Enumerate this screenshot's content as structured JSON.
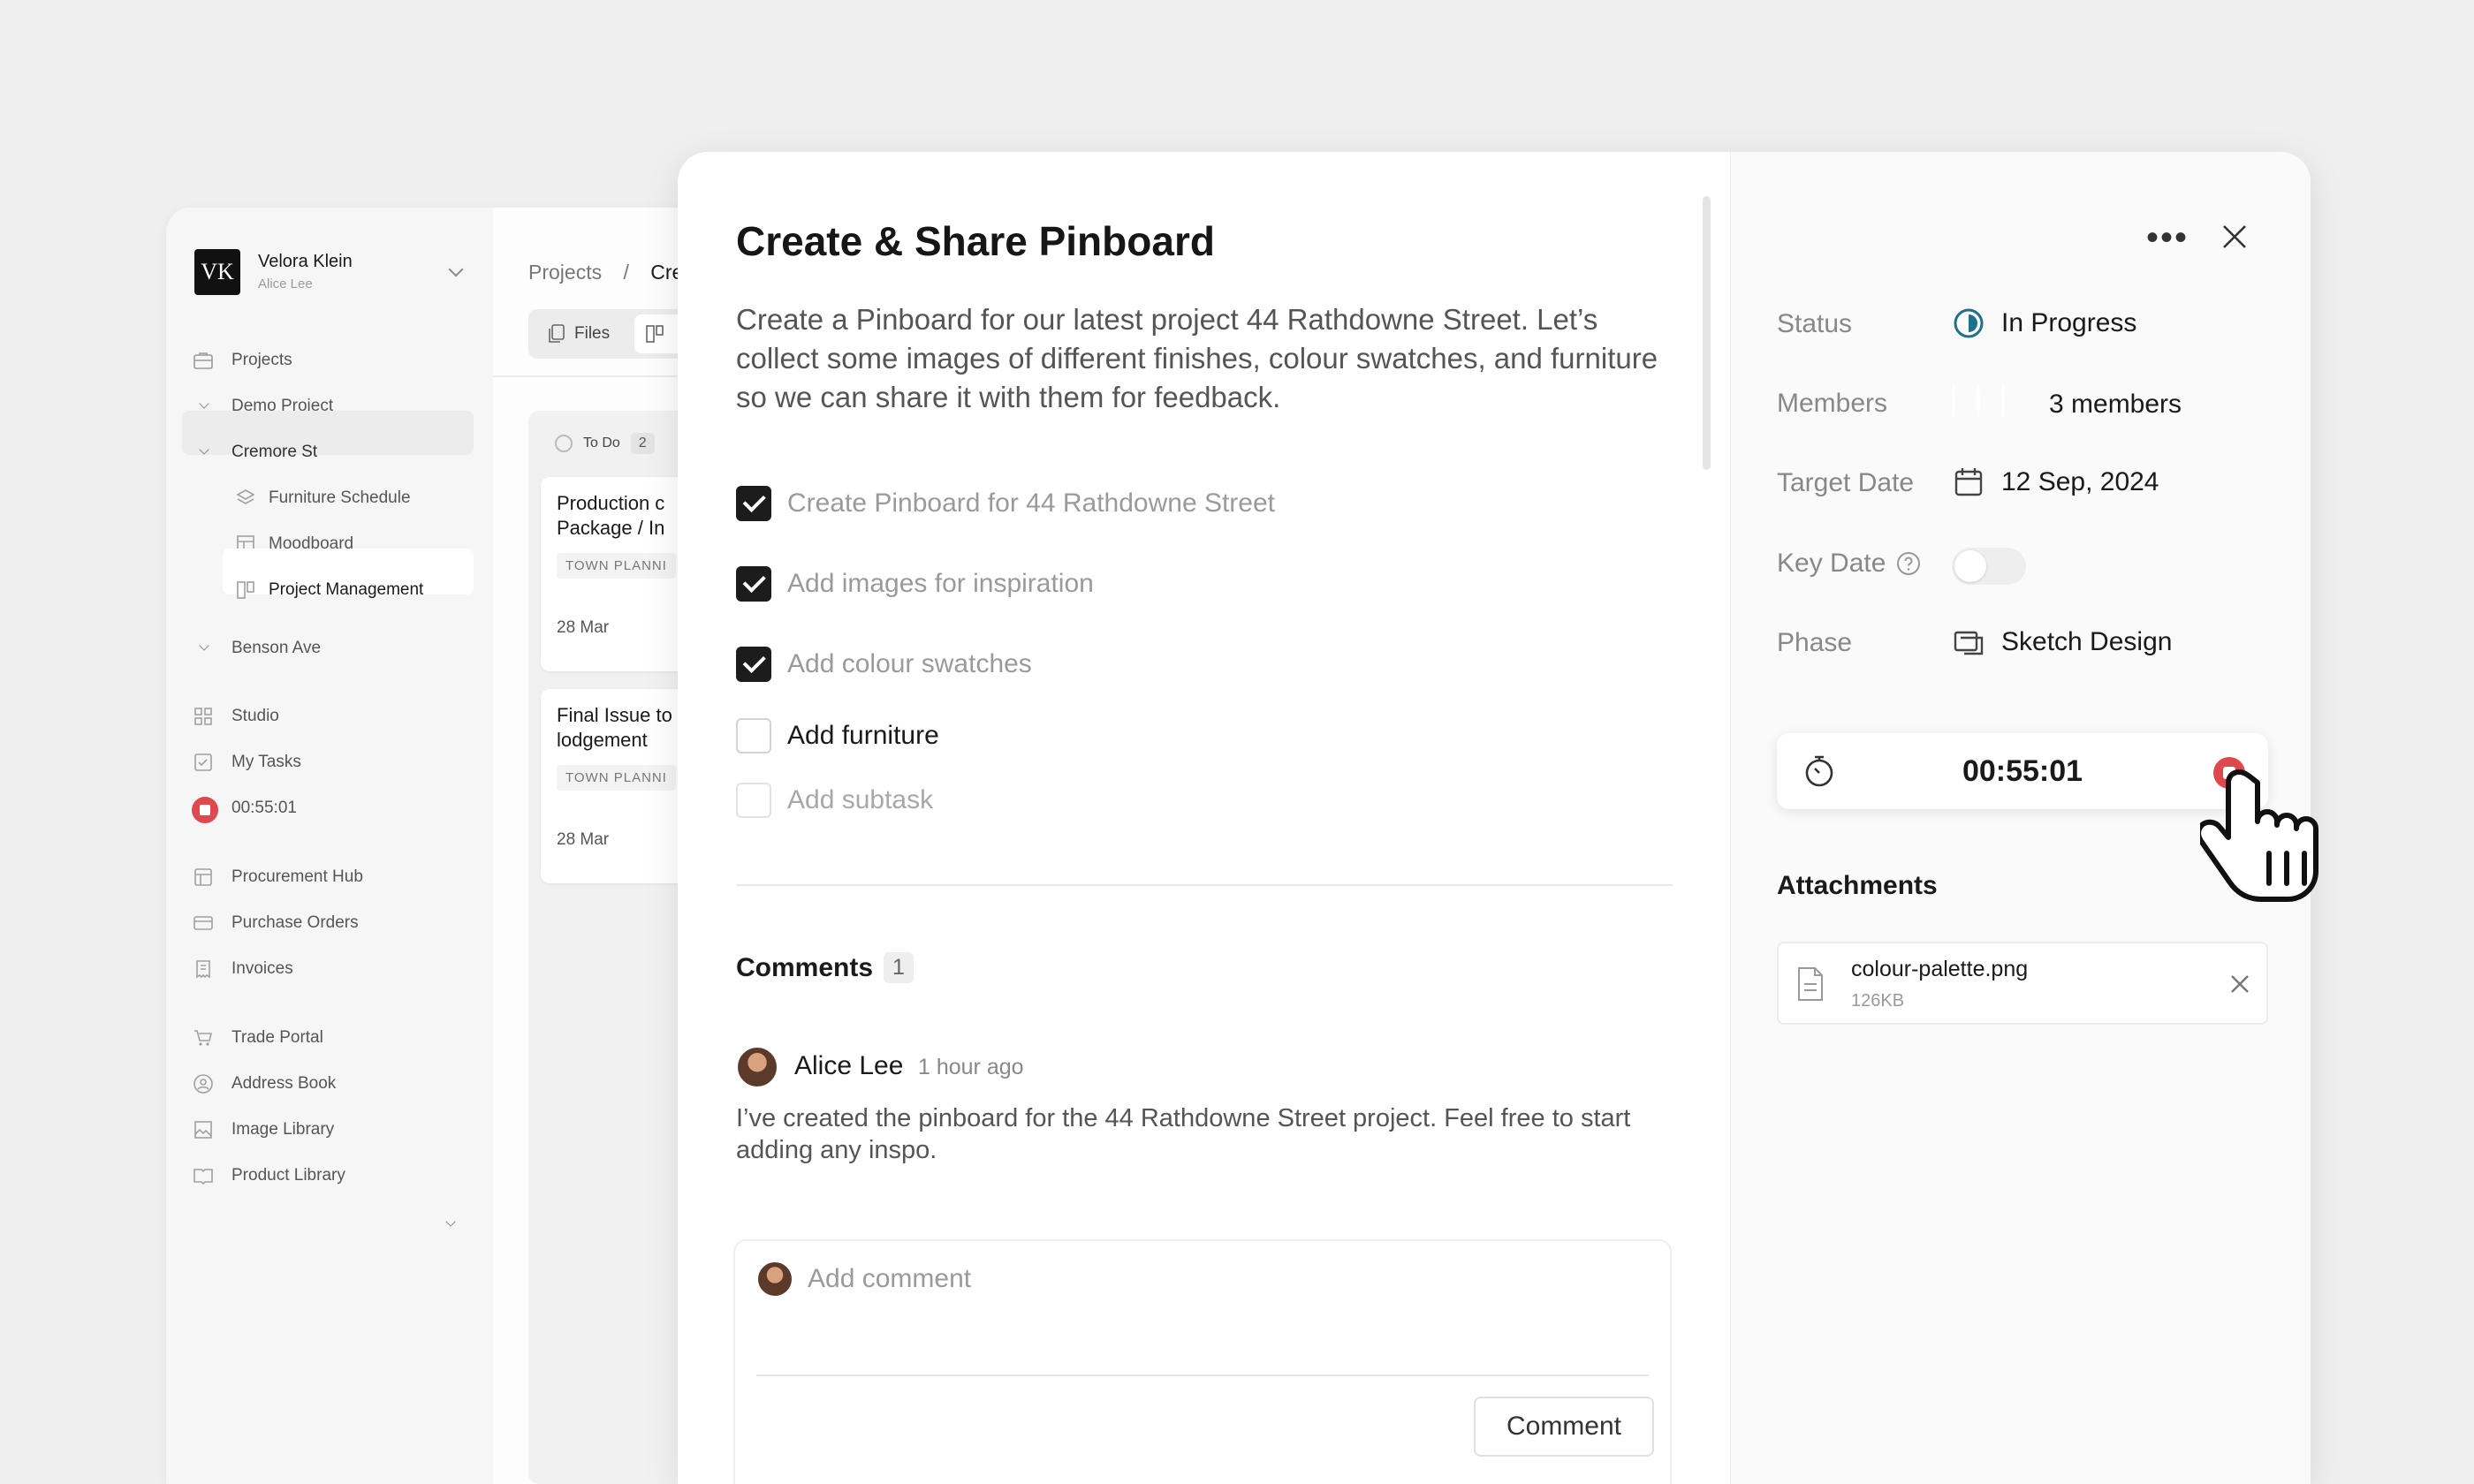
{
  "workspace": {
    "initials": "VK",
    "name": "Velora Klein",
    "user": "Alice Lee"
  },
  "sidebar": {
    "items": [
      {
        "label": "Projects",
        "icon": "briefcase-icon"
      },
      {
        "label": "Demo Project",
        "icon": "chevron-down-icon"
      },
      {
        "label": "Cremore St",
        "icon": "chevron-down-icon"
      },
      {
        "label": "Furniture Schedule",
        "icon": "layers-icon"
      },
      {
        "label": "Moodboard",
        "icon": "grid-layout-icon"
      },
      {
        "label": "Project Management",
        "icon": "kanban-icon"
      },
      {
        "label": "Benson Ave",
        "icon": "chevron-down-icon"
      },
      {
        "label": "Studio",
        "icon": "four-squares-icon"
      },
      {
        "label": "My Tasks",
        "icon": "checkbox-icon"
      },
      {
        "label": "00:55:01",
        "icon": "stop-icon"
      },
      {
        "label": "Procurement Hub",
        "icon": "procurement-icon"
      },
      {
        "label": "Purchase Orders",
        "icon": "card-icon"
      },
      {
        "label": "Invoices",
        "icon": "receipt-icon"
      },
      {
        "label": "Trade Portal",
        "icon": "cart-icon"
      },
      {
        "label": "Address Book",
        "icon": "person-circle-icon"
      },
      {
        "label": "Image Library",
        "icon": "image-icon"
      },
      {
        "label": "Product Library",
        "icon": "book-icon"
      }
    ]
  },
  "main": {
    "breadcrumb": {
      "root": "Projects",
      "separator": "/",
      "current": "Cre"
    },
    "view_files_label": "Files",
    "column": {
      "title": "To Do",
      "count": "2"
    },
    "cards": [
      {
        "title_line1": "Production c",
        "title_line2": "Package / In",
        "tag": "TOWN PLANNI",
        "date": "28 Mar"
      },
      {
        "title_line1": "Final Issue to",
        "title_line2": "lodgement",
        "tag": "TOWN PLANNI",
        "date": "28 Mar"
      }
    ]
  },
  "task": {
    "title": "Create & Share Pinboard",
    "description": "Create a Pinboard for our latest project 44 Rathdowne Street. Let’s collect some images of different finishes, colour swatches, and furniture so we can share it with them for feedback.",
    "subtasks": [
      {
        "label": "Create Pinboard for 44 Rathdowne Street",
        "done": true
      },
      {
        "label": "Add images for inspiration",
        "done": true
      },
      {
        "label": "Add colour swatches",
        "done": true
      },
      {
        "label": "Add furniture",
        "done": false
      }
    ],
    "add_subtask_placeholder": "Add subtask"
  },
  "comments": {
    "title": "Comments",
    "count": "1",
    "items": [
      {
        "author": "Alice Lee",
        "time": "1 hour ago",
        "body": "I’ve created the pinboard for the 44 Rathdowne Street project. Feel free to start adding any inspo."
      }
    ],
    "compose_placeholder": "Add comment",
    "submit_label": "Comment"
  },
  "properties": {
    "status": {
      "label": "Status",
      "value": "In Progress"
    },
    "members": {
      "label": "Members",
      "value": "3 members"
    },
    "target_date": {
      "label": "Target Date",
      "value": "12 Sep, 2024"
    },
    "key_date": {
      "label": "Key Date",
      "enabled": false
    },
    "phase": {
      "label": "Phase",
      "value": "Sketch Design"
    }
  },
  "timer": {
    "value": "00:55:01"
  },
  "attachments": {
    "title": "Attachments",
    "items": [
      {
        "name": "colour-palette.png",
        "size": "126KB"
      }
    ]
  },
  "colors": {
    "accent_status": "#1f6f8b",
    "timer_stop": "#e0484f",
    "checkbox_on": "#1c1c1c"
  }
}
